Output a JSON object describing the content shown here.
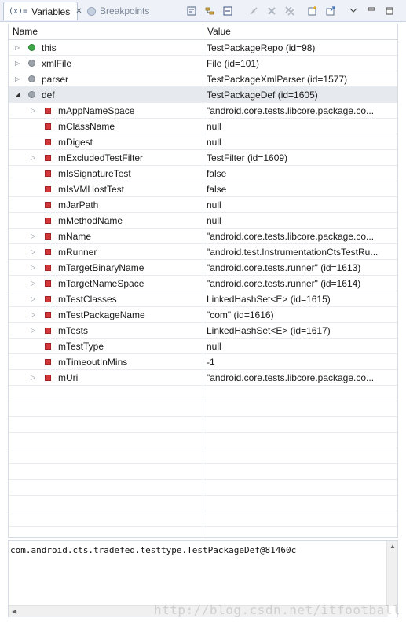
{
  "tabs": [
    {
      "label": "Variables",
      "glyph": "(x)=",
      "icon": "variables-icon",
      "active": true
    },
    {
      "label": "Breakpoints",
      "icon": "breakpoint-icon",
      "active": false
    }
  ],
  "toolbar_icons": [
    "show-type-names-icon",
    "show-logical-structure-icon",
    "collapse-all-icon",
    "disconnect-icon",
    "remove-icon",
    "remove-all-icon",
    "new-watch-icon",
    "export-icon",
    "view-menu-icon",
    "minimize-icon",
    "maximize-icon"
  ],
  "columns": {
    "name": "Name",
    "value": "Value"
  },
  "rows": [
    {
      "name": "this",
      "value": "TestPackageRepo  (id=98)",
      "icon": "local-green",
      "expand": "collapsed",
      "level": 0
    },
    {
      "name": "xmlFile",
      "value": "File  (id=101)",
      "icon": "local-gray",
      "expand": "collapsed",
      "level": 0
    },
    {
      "name": "parser",
      "value": "TestPackageXmlParser  (id=1577)",
      "icon": "local-gray",
      "expand": "collapsed",
      "level": 0
    },
    {
      "name": "def",
      "value": "TestPackageDef  (id=1605)",
      "icon": "local-gray",
      "expand": "expanded",
      "level": 0,
      "selected": true
    },
    {
      "name": "mAppNameSpace",
      "value": "\"android.core.tests.libcore.package.co...",
      "icon": "field-red",
      "expand": "collapsed",
      "level": 1
    },
    {
      "name": "mClassName",
      "value": "null",
      "icon": "field-red",
      "expand": "none",
      "level": 1
    },
    {
      "name": "mDigest",
      "value": "null",
      "icon": "field-red",
      "expand": "none",
      "level": 1
    },
    {
      "name": "mExcludedTestFilter",
      "value": "TestFilter  (id=1609)",
      "icon": "field-red",
      "expand": "collapsed",
      "level": 1
    },
    {
      "name": "mIsSignatureTest",
      "value": "false",
      "icon": "field-red",
      "expand": "none",
      "level": 1
    },
    {
      "name": "mIsVMHostTest",
      "value": "false",
      "icon": "field-red",
      "expand": "none",
      "level": 1
    },
    {
      "name": "mJarPath",
      "value": "null",
      "icon": "field-red",
      "expand": "none",
      "level": 1
    },
    {
      "name": "mMethodName",
      "value": "null",
      "icon": "field-red",
      "expand": "none",
      "level": 1
    },
    {
      "name": "mName",
      "value": "\"android.core.tests.libcore.package.co...",
      "icon": "field-red",
      "expand": "collapsed",
      "level": 1
    },
    {
      "name": "mRunner",
      "value": "\"android.test.InstrumentationCtsTestRu...",
      "icon": "field-red",
      "expand": "collapsed",
      "level": 1
    },
    {
      "name": "mTargetBinaryName",
      "value": "\"android.core.tests.runner\" (id=1613)",
      "icon": "field-red",
      "expand": "collapsed",
      "level": 1
    },
    {
      "name": "mTargetNameSpace",
      "value": "\"android.core.tests.runner\" (id=1614)",
      "icon": "field-red",
      "expand": "collapsed",
      "level": 1
    },
    {
      "name": "mTestClasses",
      "value": "LinkedHashSet<E>  (id=1615)",
      "icon": "field-red",
      "expand": "collapsed",
      "level": 1
    },
    {
      "name": "mTestPackageName",
      "value": "\"com\" (id=1616)",
      "icon": "field-red",
      "expand": "collapsed",
      "level": 1
    },
    {
      "name": "mTests",
      "value": "LinkedHashSet<E>  (id=1617)",
      "icon": "field-red",
      "expand": "collapsed",
      "level": 1
    },
    {
      "name": "mTestType",
      "value": "null",
      "icon": "field-red",
      "expand": "none",
      "level": 1
    },
    {
      "name": "mTimeoutInMins",
      "value": "-1",
      "icon": "field-red",
      "expand": "none",
      "level": 1
    },
    {
      "name": "mUri",
      "value": "\"android.core.tests.libcore.package.co...",
      "icon": "field-red",
      "expand": "collapsed",
      "level": 1
    }
  ],
  "empty_rows": 10,
  "detail": {
    "text": "com.android.cts.tradefed.testtype.TestPackageDef@81460c"
  },
  "watermark": "http://blog.csdn.net/itfootball"
}
